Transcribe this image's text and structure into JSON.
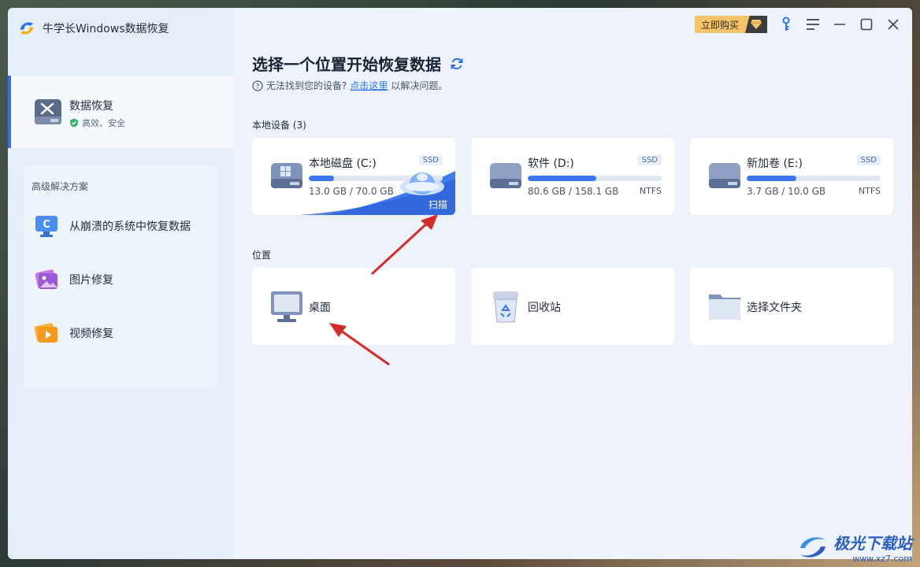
{
  "app": {
    "title": "牛学长Windows数据恢复"
  },
  "sidebar": {
    "main_item": {
      "title": "数据恢复",
      "subtitle": "高效、安全"
    },
    "advanced": {
      "title": "高级解决方案",
      "items": [
        {
          "label": "从崩溃的系统中恢复数据",
          "icon": "computer-c-icon"
        },
        {
          "label": "图片修复",
          "icon": "photo-repair-icon"
        },
        {
          "label": "视频修复",
          "icon": "video-repair-icon"
        }
      ]
    }
  },
  "topbar": {
    "buy_label": "立即购买"
  },
  "main": {
    "heading": "选择一个位置开始恢复数据",
    "help_prefix": "无法找到您的设备?",
    "help_link": "点击这里",
    "help_suffix": "以解决问题。",
    "local_devices_label": "本地设备 (3)",
    "locations_label": "位置"
  },
  "drives": [
    {
      "name": "本地磁盘 (C:)",
      "type": "SSD",
      "usage": "13.0 GB / 70.0 GB",
      "fs": "",
      "used_fraction": 0.186,
      "scan_label": "扫描"
    },
    {
      "name": "软件 (D:)",
      "type": "SSD",
      "usage": "80.6 GB / 158.1 GB",
      "fs": "NTFS",
      "used_fraction": 0.51
    },
    {
      "name": "新加卷 (E:)",
      "type": "SSD",
      "usage": "3.7 GB / 10.0 GB",
      "fs": "NTFS",
      "used_fraction": 0.37
    }
  ],
  "locations": [
    {
      "name": "桌面",
      "icon": "desktop-icon"
    },
    {
      "name": "回收站",
      "icon": "recycle-bin-icon"
    },
    {
      "name": "选择文件夹",
      "icon": "folder-icon"
    }
  ],
  "watermark": {
    "text": "极光下载站",
    "url": "www.xz7.com"
  },
  "colors": {
    "accent": "#2e6ff2",
    "bar_fill": "#3d74f0",
    "buy_button": "#f3c46a",
    "arrow": "#d42a2a"
  }
}
